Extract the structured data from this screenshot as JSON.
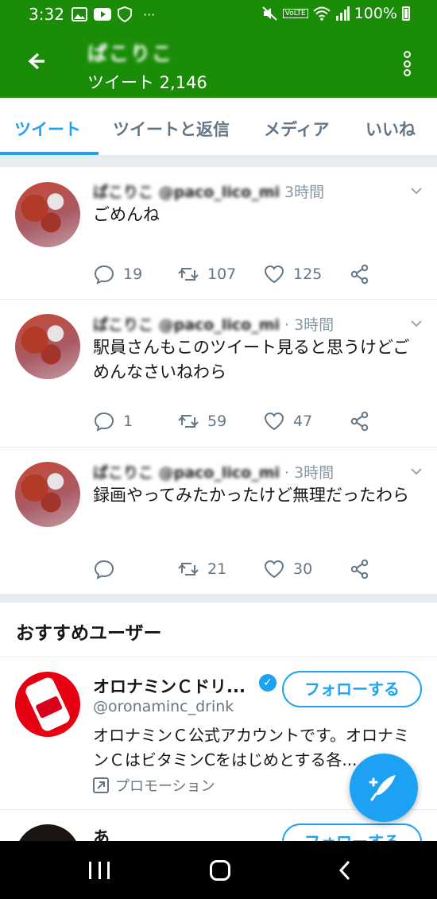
{
  "status_bar": {
    "time": "3:32",
    "dots": "···",
    "network": "VoLTE",
    "battery": "100%"
  },
  "header": {
    "user_name": "ぱこりこ",
    "tweet_count": "ツイート 2,146"
  },
  "tabs": [
    {
      "label": "ツイート",
      "active": true
    },
    {
      "label": "ツイートと返信",
      "active": false
    },
    {
      "label": "メディア",
      "active": false
    },
    {
      "label": "いいね",
      "active": false
    }
  ],
  "tweets": [
    {
      "author": "ぱこりこ @paco_lico_mi",
      "time": "3時間",
      "text": "ごめんね",
      "replies": "19",
      "retweets": "107",
      "likes": "125"
    },
    {
      "author": "ぱこりこ @paco_lico_mi",
      "time": "· 3時間",
      "text": "駅員さんもこのツイート見ると思うけどごめんなさいねわら",
      "replies": "1",
      "retweets": "59",
      "likes": "47"
    },
    {
      "author": "ぱこりこ @paco_lico_mi",
      "time": "· 3時間",
      "text": "録画やってみたかったけど無理だったわら",
      "replies": "",
      "retweets": "21",
      "likes": "30"
    }
  ],
  "recommended": {
    "title": "おすすめユーザー",
    "users": [
      {
        "name": "オロナミンＣドリ...",
        "handle": "@oronaminc_drink",
        "bio": "オロナミンＣ公式アカウントです。オロナミンＣはビタミンCをはじめとする各...",
        "promo": "プロモーション",
        "follow_label": "フォローする"
      },
      {
        "name": "あ",
        "follow_label": "フォローする"
      }
    ]
  }
}
